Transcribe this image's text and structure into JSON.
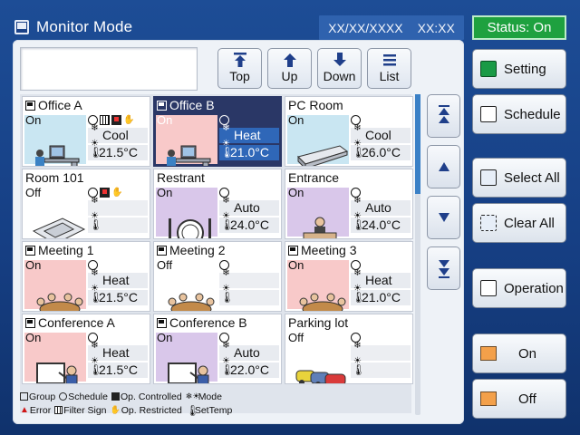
{
  "title": "Monitor Mode",
  "datetime": {
    "date": "XX/XX/XXXX",
    "time": "XX:XX"
  },
  "status_text": "Status:  On",
  "nav": [
    {
      "label": "Top",
      "icon": "arrow-to-top-icon"
    },
    {
      "label": "Up",
      "icon": "arrow-up-icon"
    },
    {
      "label": "Down",
      "icon": "arrow-down-icon"
    },
    {
      "label": "List",
      "icon": "list-icon"
    }
  ],
  "tiles": [
    {
      "name": "Office A",
      "state": "On",
      "mode": "Cool",
      "temp": "21.5°C",
      "pic": "desk",
      "bg": "on-cool"
    },
    {
      "name": "Office B",
      "state": "On",
      "mode": "Heat",
      "temp": "21.0°C",
      "pic": "desk",
      "bg": "on-heat",
      "selected": true
    },
    {
      "name": "PC Room",
      "state": "On",
      "mode": "Cool",
      "temp": "26.0°C",
      "pic": "ceiling-unit",
      "bg": "on-cool"
    },
    {
      "name": "Room 101",
      "state": "Off",
      "mode": "",
      "temp": "",
      "pic": "cassette",
      "bg": "off"
    },
    {
      "name": "Restrant",
      "state": "On",
      "mode": "Auto",
      "temp": "24.0°C",
      "pic": "plate",
      "bg": "on-auto"
    },
    {
      "name": "Entrance",
      "state": "On",
      "mode": "Auto",
      "temp": "24.0°C",
      "pic": "reception",
      "bg": "on-auto"
    },
    {
      "name": "Meeting 1",
      "state": "On",
      "mode": "Heat",
      "temp": "21.5°C",
      "pic": "meeting",
      "bg": "on-heat"
    },
    {
      "name": "Meeting 2",
      "state": "Off",
      "mode": "",
      "temp": "",
      "pic": "meeting",
      "bg": "off"
    },
    {
      "name": "Meeting 3",
      "state": "On",
      "mode": "Heat",
      "temp": "21.0°C",
      "pic": "meeting",
      "bg": "on-heat"
    },
    {
      "name": "Conference A",
      "state": "On",
      "mode": "Heat",
      "temp": "21.5°C",
      "pic": "presenter",
      "bg": "on-heat"
    },
    {
      "name": "Conference B",
      "state": "On",
      "mode": "Auto",
      "temp": "22.0°C",
      "pic": "presenter",
      "bg": "on-auto"
    },
    {
      "name": "Parking lot",
      "state": "Off",
      "mode": "",
      "temp": "",
      "pic": "cars",
      "bg": "off"
    }
  ],
  "legend": {
    "row1": [
      "Group",
      "Schedule",
      "Op. Controlled",
      "Mode"
    ],
    "row2": [
      "Error",
      "Filter Sign",
      "Op. Restricted",
      "SetTemp"
    ]
  },
  "right_buttons": {
    "setting": "Setting",
    "schedule": "Schedule",
    "select_all": "Select All",
    "clear_all": "Clear All",
    "operation": "Operation",
    "on": "On",
    "off": "Off"
  },
  "colors": {
    "background": "#163f84",
    "status_green": "#1ea13f",
    "selected_tile": "#2a3766",
    "cool_bg": "#c9e6f2",
    "heat_bg": "#f8c9c9",
    "auto_bg": "#d9c7ea",
    "orange_indicator": "#f3a04a"
  }
}
